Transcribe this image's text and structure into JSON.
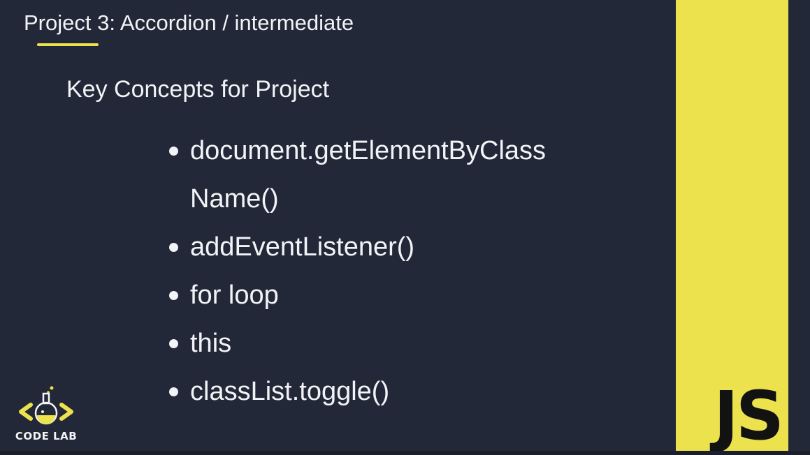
{
  "header": {
    "title": "Project 3: Accordion / intermediate"
  },
  "section": {
    "heading": "Key Concepts for Project"
  },
  "concepts": [
    "document.getElementByClassName()",
    "addEventListener()",
    "for loop",
    "this",
    "classList.toggle()"
  ],
  "logo": {
    "text": "CODE LAB",
    "icon": "code-lab-flask-icon"
  },
  "badge": {
    "label": "JS"
  },
  "colors": {
    "background": "#232838",
    "accent": "#ece24e",
    "text": "#f2f3f6"
  }
}
